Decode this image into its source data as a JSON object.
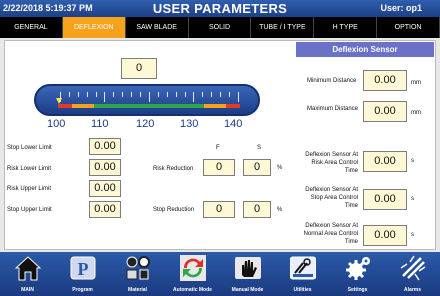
{
  "titlebar": {
    "datetime": "2/22/2018 5:19:37 PM",
    "title": "USER PARAMETERS",
    "user": "User: op1"
  },
  "tabs": [
    {
      "label": "GENERAL",
      "active": false
    },
    {
      "label": "DEFLEXION",
      "active": true
    },
    {
      "label": "SAW BLADE",
      "active": false
    },
    {
      "label": "SOLID",
      "active": false
    },
    {
      "label": "TUBE / I TYPE",
      "active": false
    },
    {
      "label": "H TYPE",
      "active": false
    },
    {
      "label": "OPTION",
      "active": false
    }
  ],
  "gauge": {
    "value": "0",
    "scale": [
      "100",
      "110",
      "120",
      "130",
      "140"
    ],
    "colors": {
      "red": "#e23b2a",
      "orange": "#f6a31b",
      "green": "#2fa64a"
    }
  },
  "limits": {
    "stop_lower": {
      "label": "Stop Lower Limit",
      "value": "0.00"
    },
    "risk_lower": {
      "label": "Risk Lower Limit",
      "value": "0.00"
    },
    "risk_upper": {
      "label": "Risk Upper Limit",
      "value": "0.00"
    },
    "stop_upper": {
      "label": "Stop Upper Limit",
      "value": "0.00"
    }
  },
  "reduction": {
    "col_f": "F",
    "col_s": "S",
    "risk": {
      "label": "Risk Reduction",
      "f": "0",
      "s": "0",
      "unit": "%"
    },
    "stop": {
      "label": "Stop Reduction",
      "f": "0",
      "s": "0",
      "unit": "%"
    }
  },
  "sensor": {
    "header": "Deflexion Sensor",
    "min_distance": {
      "label": "Minimum Distance",
      "value": "0.00",
      "unit": "mm"
    },
    "max_distance": {
      "label": "Maximum Distance",
      "value": "0.00",
      "unit": "mm"
    },
    "risk_time": {
      "label": "Deflexion Sensor At Risk Area Control Time",
      "value": "0.00",
      "unit": "s"
    },
    "stop_time": {
      "label": "Deflexion Sensor At Stop Area Control Time",
      "value": "0.00",
      "unit": "s"
    },
    "normal_time": {
      "label": "Deflexion Sensor At Normal Area Control Time",
      "value": "0.00",
      "unit": "s"
    }
  },
  "nav": [
    {
      "label": "MAIN",
      "icon": "home-icon"
    },
    {
      "label": "Program",
      "icon": "program-icon"
    },
    {
      "label": "Material",
      "icon": "material-icon"
    },
    {
      "label": "Automatic Mode",
      "icon": "automatic-mode-icon"
    },
    {
      "label": "Manual Mode",
      "icon": "manual-mode-icon"
    },
    {
      "label": "Utilities",
      "icon": "utilities-icon"
    },
    {
      "label": "Settings",
      "icon": "settings-icon"
    },
    {
      "label": "Alarms",
      "icon": "alarms-icon"
    }
  ]
}
